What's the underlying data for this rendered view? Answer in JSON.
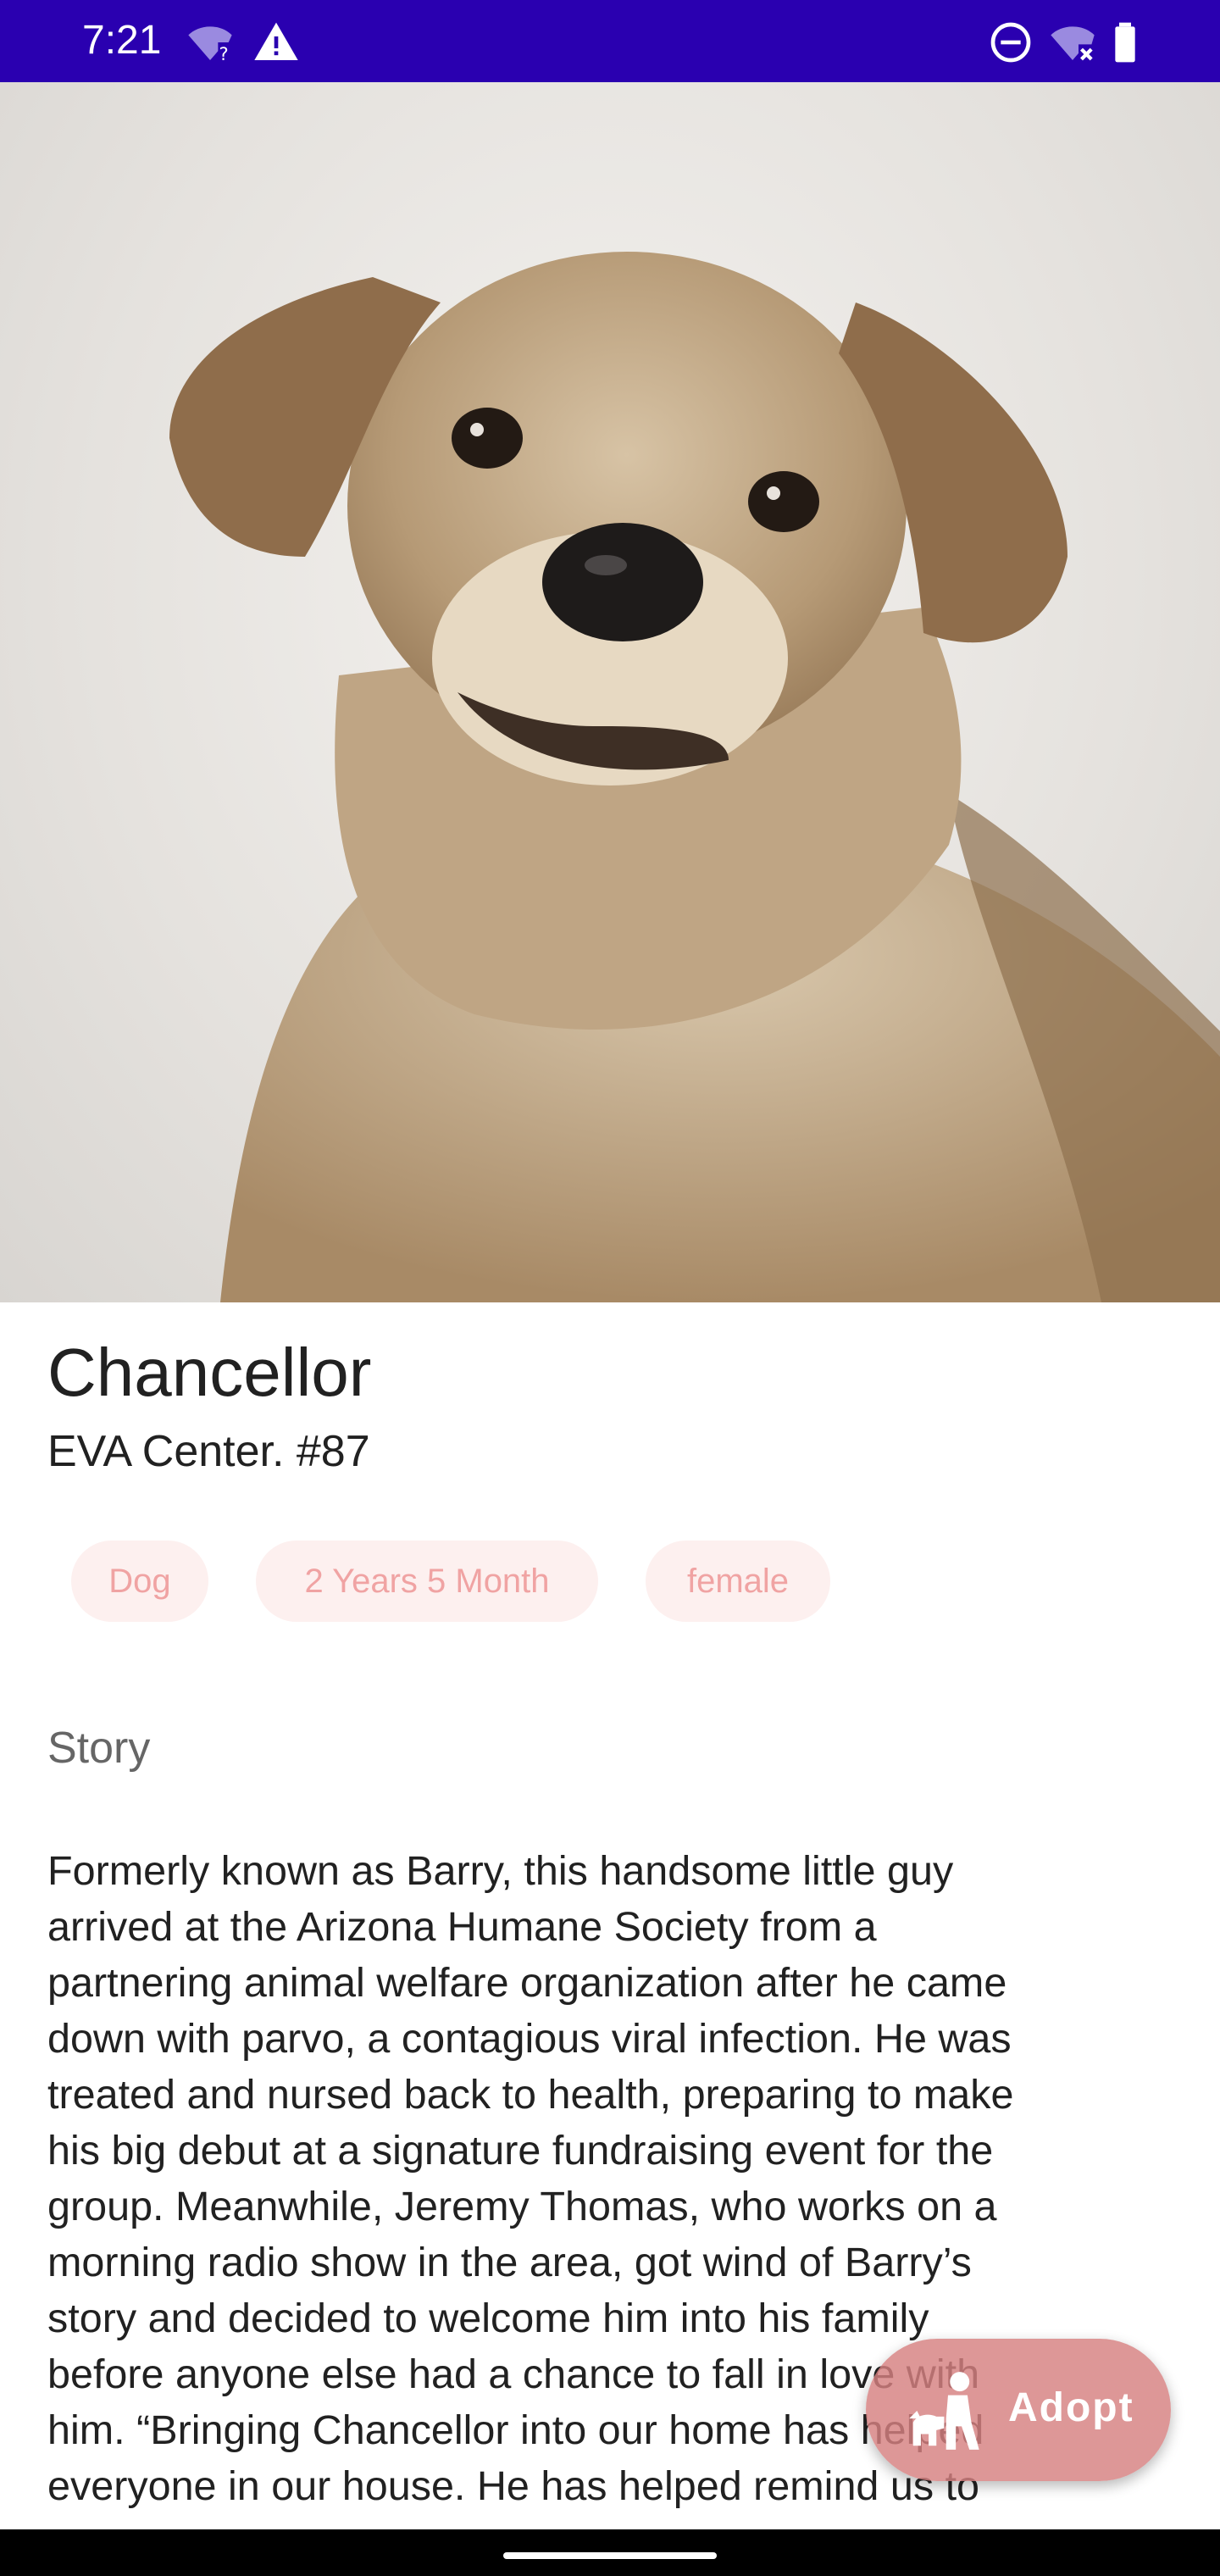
{
  "status_bar": {
    "time": "7:21",
    "left_icons": [
      "wifi-unknown-icon",
      "warning-icon"
    ],
    "right_icons": [
      "do-not-disturb-icon",
      "wifi-off-icon",
      "battery-icon"
    ],
    "background": "#2a00b0"
  },
  "pet": {
    "name": "Chancellor",
    "center": "EVA Center. #87",
    "tags": [
      "Dog",
      "2 Years 5 Month",
      "female"
    ],
    "story_title": "Story",
    "story_lines": [
      "Formerly known as Barry, this handsome little guy",
      "arrived at the Arizona Humane Society from a",
      "partnering animal welfare organization after he came",
      "down with parvo, a contagious viral infection. He was",
      "treated and nursed back to health, preparing to make",
      "his big debut at a signature fundraising event for the",
      "group. Meanwhile, Jeremy Thomas, who works on a",
      "morning radio show in the area, got wind of Barry’s",
      "story and decided to welcome him into his family",
      "before anyone else had a chance to fall in love with",
      "him. “Bringing Chancellor into our home has helped",
      "everyone in our house. He has helped remind us to"
    ]
  },
  "fab": {
    "label": "Adopt",
    "icon": "adopt-person-pet-icon"
  },
  "colors": {
    "chip_bg": "#fdf0ef",
    "chip_text": "#f0a3a3",
    "fab": "#d68080"
  }
}
